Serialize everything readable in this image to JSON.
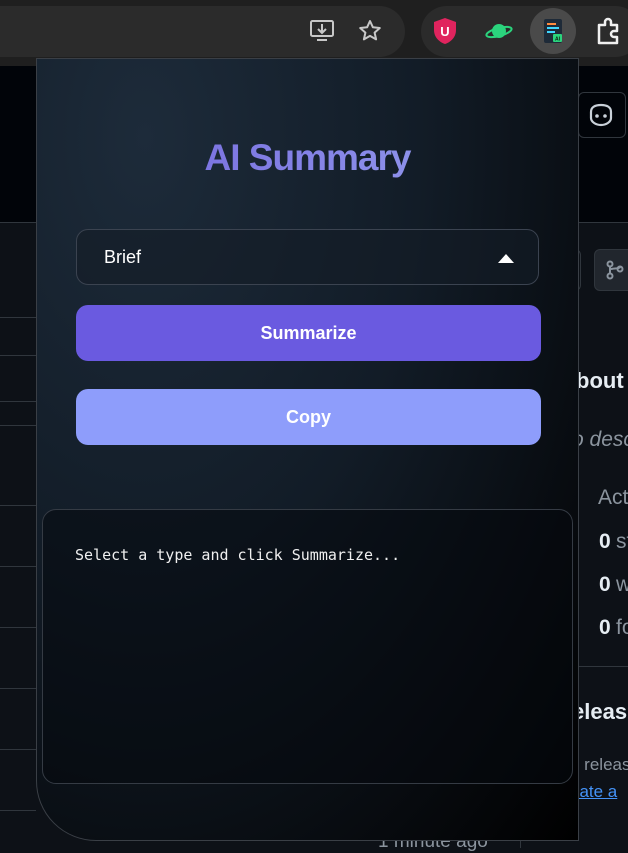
{
  "colors": {
    "title_gradient_start": "#6f5fdb",
    "title_gradient_end": "#9aa6f0",
    "summarize_button": "#6a5ae0",
    "copy_button": "#8e9dfb"
  },
  "toolbar": {
    "icons": [
      "install-app-icon",
      "bookmark-star-icon",
      "ublock-shield-icon",
      "planet-extension-icon",
      "ai-summary-extension-icon",
      "extensions-puzzle-icon"
    ],
    "ublock_letter": "U",
    "ai_ext_badge": "AI"
  },
  "popup": {
    "title": "AI Summary",
    "summary_type": {
      "selected": "Brief"
    },
    "summarize_label": "Summarize",
    "copy_label": "Copy",
    "output_placeholder": "Select a type and click Summarize..."
  },
  "background_page": {
    "about_fragment": "bout",
    "desc_fragment": "o desc",
    "activity_fragment": "Act",
    "stars_count": "0",
    "stars_fragment": "st",
    "watching_count": "0",
    "watching_fragment": "w",
    "forks_count": "0",
    "forks_fragment": "fo",
    "releases_fragment": "eleas",
    "no_releases_fragment": "o releas",
    "create_link_fragment": "eate a",
    "timestamp_fragment": "1 minute ago"
  }
}
